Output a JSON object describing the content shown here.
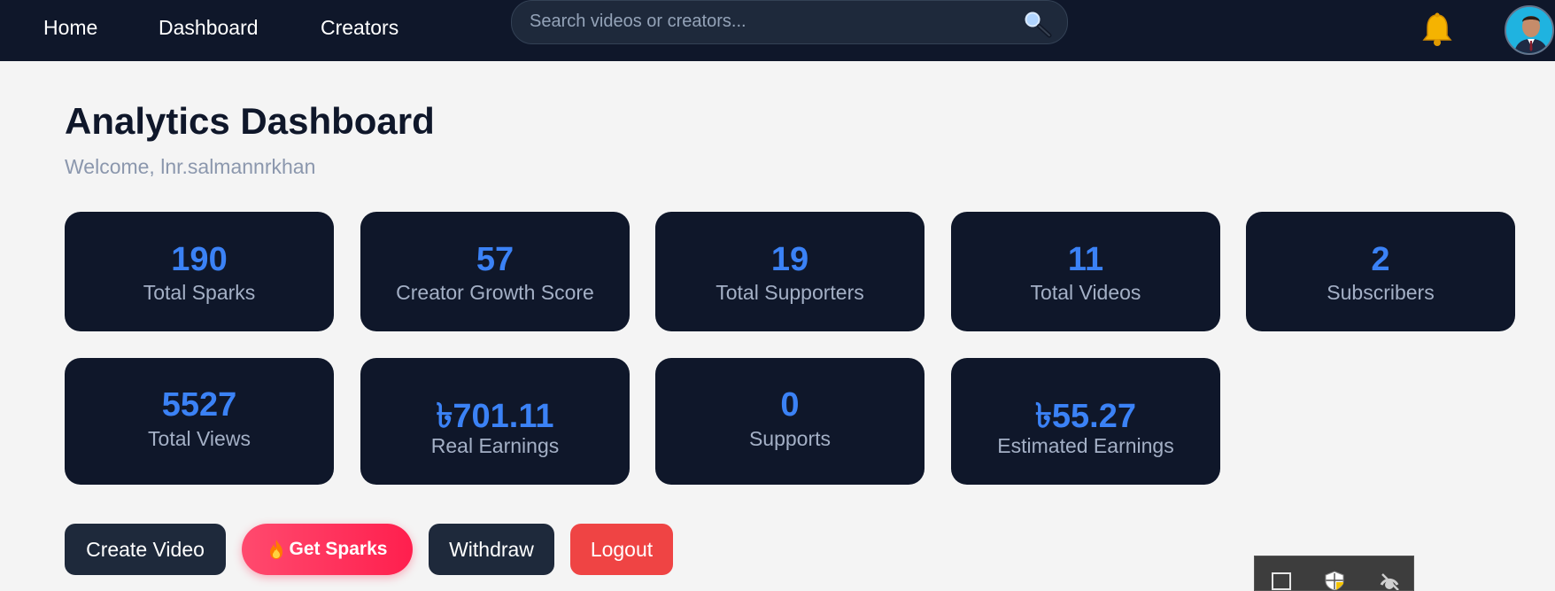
{
  "nav": {
    "home": "Home",
    "dashboard": "Dashboard",
    "creators": "Creators",
    "search_placeholder": "Search videos or creators...",
    "search_icon": "magnifier-icon",
    "notification_icon": "bell-icon",
    "avatar_icon": "user-avatar"
  },
  "page": {
    "title": "Analytics Dashboard",
    "welcome": "Welcome, lnr.salmannrkhan"
  },
  "stats": [
    {
      "value": "190",
      "label": "Total Sparks"
    },
    {
      "value": "57",
      "label": "Creator Growth Score"
    },
    {
      "value": "19",
      "label": "Total Supporters"
    },
    {
      "value": "11",
      "label": "Total Videos"
    },
    {
      "value": "2",
      "label": "Subscribers"
    },
    {
      "value": "5527",
      "label": "Total Views"
    },
    {
      "value": "৳701.11",
      "label": "Real Earnings"
    },
    {
      "value": "0",
      "label": "Supports"
    },
    {
      "value": "৳55.27",
      "label": "Estimated Earnings"
    }
  ],
  "actions": {
    "create_video": "Create Video",
    "get_sparks": "Get Sparks",
    "get_sparks_icon": "fire-icon",
    "withdraw": "Withdraw",
    "logout": "Logout"
  },
  "colors": {
    "nav_bg": "#0f172a",
    "card_bg": "#0f172a",
    "accent": "#3b82f6",
    "logout": "#ef4444",
    "sparks": "#ff2d55"
  }
}
